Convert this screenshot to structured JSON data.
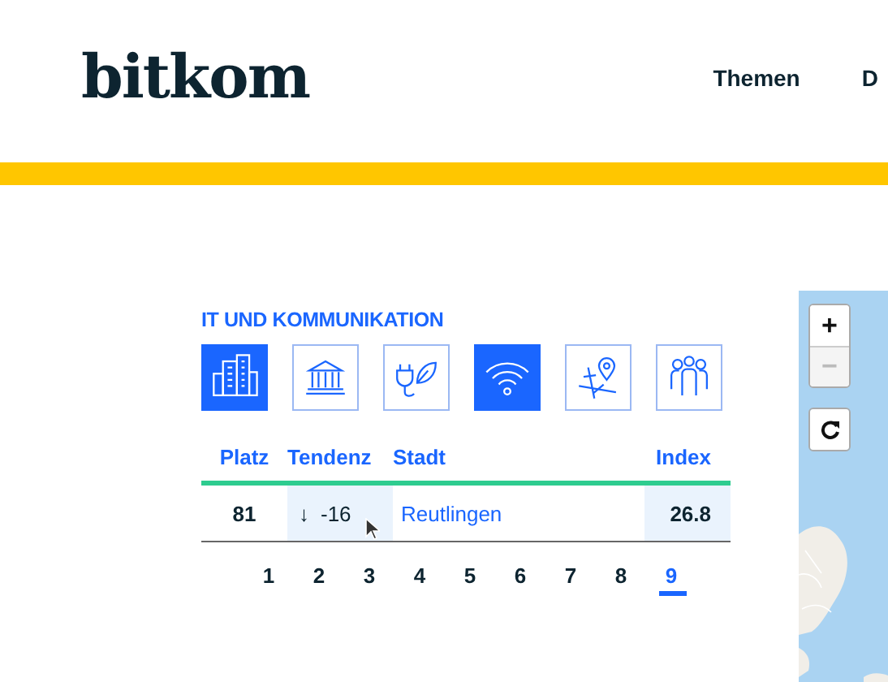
{
  "header": {
    "logo": "bitkom",
    "nav": [
      {
        "label": "Themen"
      },
      {
        "label": "D"
      }
    ]
  },
  "ranking": {
    "title": "IT UND KOMMUNIKATION",
    "categories": [
      {
        "kind": "buildings",
        "selected": true
      },
      {
        "kind": "institution",
        "selected": false
      },
      {
        "kind": "energy",
        "selected": false
      },
      {
        "kind": "wifi",
        "selected": true
      },
      {
        "kind": "map",
        "selected": false
      },
      {
        "kind": "people",
        "selected": false
      }
    ],
    "columns": [
      "Platz",
      "Tendenz",
      "Stadt",
      "Index"
    ],
    "rows": [
      {
        "rank": "81",
        "trend_arrow": "↓",
        "trend": "-16",
        "city": "Reutlingen",
        "index": "26.8"
      }
    ],
    "pages": [
      {
        "label": "1",
        "selected": false
      },
      {
        "label": "2",
        "selected": false
      },
      {
        "label": "3",
        "selected": false
      },
      {
        "label": "4",
        "selected": false
      },
      {
        "label": "5",
        "selected": false
      },
      {
        "label": "6",
        "selected": false
      },
      {
        "label": "7",
        "selected": false
      },
      {
        "label": "8",
        "selected": false
      },
      {
        "label": "9",
        "selected": true
      }
    ]
  },
  "map": {
    "zoom_in": "+",
    "zoom_out": {
      "label": "−",
      "disabled": true
    }
  }
}
